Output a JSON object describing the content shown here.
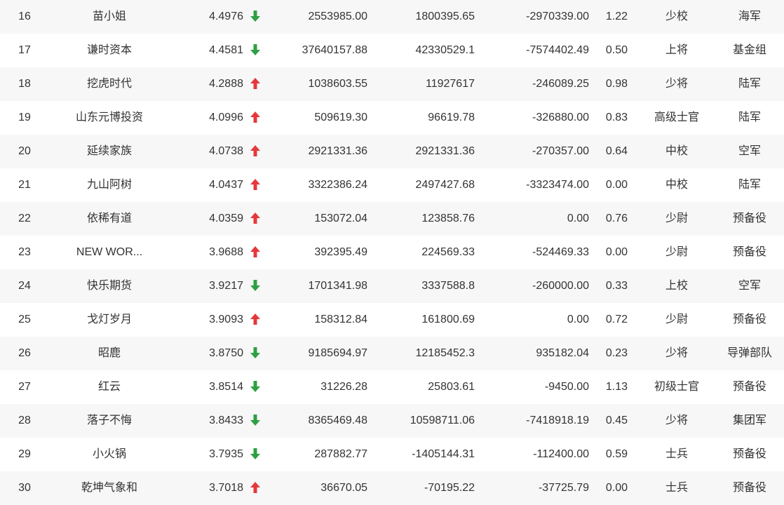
{
  "colors": {
    "up": "#e5383b",
    "down": "#2ea043",
    "row_alt": "#f7f7f7",
    "text": "#333333"
  },
  "rows": [
    {
      "rank": "16",
      "name": "苗小姐",
      "score": "4.4976",
      "trend": "down",
      "v1": "2553985.00",
      "v2": "1800395.65",
      "v3": "-2970339.00",
      "ratio": "1.22",
      "title": "少校",
      "branch": "海军"
    },
    {
      "rank": "17",
      "name": "谦时资本",
      "score": "4.4581",
      "trend": "down",
      "v1": "37640157.88",
      "v2": "42330529.1",
      "v3": "-7574402.49",
      "ratio": "0.50",
      "title": "上将",
      "branch": "基金组"
    },
    {
      "rank": "18",
      "name": "挖虎时代",
      "score": "4.2888",
      "trend": "up",
      "v1": "1038603.55",
      "v2": "11927617",
      "v3": "-246089.25",
      "ratio": "0.98",
      "title": "少将",
      "branch": "陆军"
    },
    {
      "rank": "19",
      "name": "山东元博投资",
      "score": "4.0996",
      "trend": "up",
      "v1": "509619.30",
      "v2": "96619.78",
      "v3": "-326880.00",
      "ratio": "0.83",
      "title": "高级士官",
      "branch": "陆军"
    },
    {
      "rank": "20",
      "name": "延续家族",
      "score": "4.0738",
      "trend": "up",
      "v1": "2921331.36",
      "v2": "2921331.36",
      "v3": "-270357.00",
      "ratio": "0.64",
      "title": "中校",
      "branch": "空军"
    },
    {
      "rank": "21",
      "name": "九山阿树",
      "score": "4.0437",
      "trend": "up",
      "v1": "3322386.24",
      "v2": "2497427.68",
      "v3": "-3323474.00",
      "ratio": "0.00",
      "title": "中校",
      "branch": "陆军"
    },
    {
      "rank": "22",
      "name": "依稀有道",
      "score": "4.0359",
      "trend": "up",
      "v1": "153072.04",
      "v2": "123858.76",
      "v3": "0.00",
      "ratio": "0.76",
      "title": "少尉",
      "branch": "预备役"
    },
    {
      "rank": "23",
      "name": "NEW WOR...",
      "score": "3.9688",
      "trend": "up",
      "v1": "392395.49",
      "v2": "224569.33",
      "v3": "-524469.33",
      "ratio": "0.00",
      "title": "少尉",
      "branch": "预备役"
    },
    {
      "rank": "24",
      "name": "快乐期货",
      "score": "3.9217",
      "trend": "down",
      "v1": "1701341.98",
      "v2": "3337588.8",
      "v3": "-260000.00",
      "ratio": "0.33",
      "title": "上校",
      "branch": "空军"
    },
    {
      "rank": "25",
      "name": "戈灯岁月",
      "score": "3.9093",
      "trend": "up",
      "v1": "158312.84",
      "v2": "161800.69",
      "v3": "0.00",
      "ratio": "0.72",
      "title": "少尉",
      "branch": "预备役"
    },
    {
      "rank": "26",
      "name": "昭鹿",
      "score": "3.8750",
      "trend": "down",
      "v1": "9185694.97",
      "v2": "12185452.3",
      "v3": "935182.04",
      "ratio": "0.23",
      "title": "少将",
      "branch": "导弹部队"
    },
    {
      "rank": "27",
      "name": "红云",
      "score": "3.8514",
      "trend": "down",
      "v1": "31226.28",
      "v2": "25803.61",
      "v3": "-9450.00",
      "ratio": "1.13",
      "title": "初级士官",
      "branch": "预备役"
    },
    {
      "rank": "28",
      "name": "落子不悔",
      "score": "3.8433",
      "trend": "down",
      "v1": "8365469.48",
      "v2": "10598711.06",
      "v3": "-7418918.19",
      "ratio": "0.45",
      "title": "少将",
      "branch": "集团军"
    },
    {
      "rank": "29",
      "name": "小火锅",
      "score": "3.7935",
      "trend": "down",
      "v1": "287882.77",
      "v2": "-1405144.31",
      "v3": "-112400.00",
      "ratio": "0.59",
      "title": "士兵",
      "branch": "预备役"
    },
    {
      "rank": "30",
      "name": "乾坤气象和",
      "score": "3.7018",
      "trend": "up",
      "v1": "36670.05",
      "v2": "-70195.22",
      "v3": "-37725.79",
      "ratio": "0.00",
      "title": "士兵",
      "branch": "预备役"
    }
  ]
}
